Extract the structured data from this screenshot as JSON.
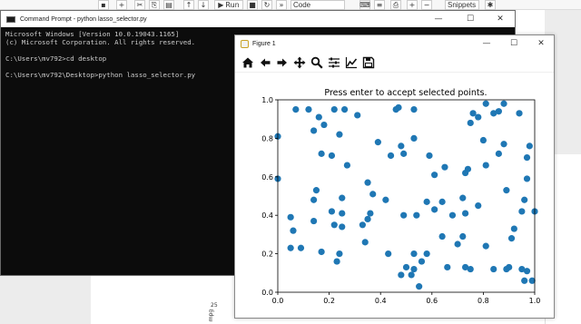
{
  "background": {
    "toolbar": {
      "run_label": "Run",
      "cell_type": "Code",
      "snippets_label": "Snippets"
    },
    "axis_tick": "25",
    "axis_label": "mpg"
  },
  "cmd": {
    "title": "Command Prompt - python  lasso_selector.py",
    "lines": [
      "Microsoft Windows [Version 10.0.19043.1165]",
      "(c) Microsoft Corporation. All rights reserved.",
      "",
      "C:\\Users\\mv792>cd desktop",
      "",
      "C:\\Users\\mv792\\Desktop>python lasso_selector.py"
    ]
  },
  "figure": {
    "title": "Figure 1",
    "toolbar_icons": [
      "home-icon",
      "back-arrow-icon",
      "forward-arrow-icon",
      "pan-icon",
      "zoom-icon",
      "subplots-icon",
      "axes-edit-icon",
      "save-icon"
    ]
  },
  "chart_data": {
    "type": "scatter",
    "title": "Press enter to accept selected points.",
    "xlabel": "",
    "ylabel": "",
    "xlim": [
      0,
      1
    ],
    "ylim": [
      0,
      1
    ],
    "xticks": [
      "0.0",
      "0.2",
      "0.4",
      "0.6",
      "0.8",
      "1.0"
    ],
    "yticks": [
      "0.0",
      "0.2",
      "0.4",
      "0.6",
      "0.8",
      "1.0"
    ],
    "grid": false,
    "color": "#1f77b4",
    "points": [
      [
        0.0,
        0.81
      ],
      [
        0.07,
        0.95
      ],
      [
        0.12,
        0.95
      ],
      [
        0.16,
        0.91
      ],
      [
        0.22,
        0.95
      ],
      [
        0.26,
        0.95
      ],
      [
        0.31,
        0.92
      ],
      [
        0.47,
        0.96
      ],
      [
        0.46,
        0.95
      ],
      [
        0.53,
        0.95
      ],
      [
        0.76,
        0.93
      ],
      [
        0.81,
        0.98
      ],
      [
        0.84,
        0.93
      ],
      [
        0.86,
        0.94
      ],
      [
        0.88,
        0.98
      ],
      [
        0.94,
        0.93
      ],
      [
        0.78,
        0.91
      ],
      [
        0.75,
        0.88
      ],
      [
        0.18,
        0.87
      ],
      [
        0.14,
        0.84
      ],
      [
        0.24,
        0.82
      ],
      [
        0.39,
        0.78
      ],
      [
        0.53,
        0.8
      ],
      [
        0.48,
        0.76
      ],
      [
        0.44,
        0.71
      ],
      [
        0.49,
        0.72
      ],
      [
        0.59,
        0.71
      ],
      [
        0.8,
        0.79
      ],
      [
        0.88,
        0.77
      ],
      [
        0.98,
        0.76
      ],
      [
        0.97,
        0.7
      ],
      [
        0.17,
        0.72
      ],
      [
        0.21,
        0.71
      ],
      [
        0.27,
        0.66
      ],
      [
        0.65,
        0.65
      ],
      [
        0.74,
        0.64
      ],
      [
        0.73,
        0.62
      ],
      [
        0.81,
        0.66
      ],
      [
        0.86,
        0.72
      ],
      [
        0.61,
        0.61
      ],
      [
        0.0,
        0.59
      ],
      [
        0.35,
        0.57
      ],
      [
        0.97,
        0.59
      ],
      [
        0.37,
        0.51
      ],
      [
        0.15,
        0.53
      ],
      [
        0.14,
        0.48
      ],
      [
        0.25,
        0.49
      ],
      [
        0.21,
        0.42
      ],
      [
        0.25,
        0.41
      ],
      [
        0.36,
        0.41
      ],
      [
        0.42,
        0.48
      ],
      [
        0.58,
        0.47
      ],
      [
        0.64,
        0.47
      ],
      [
        0.72,
        0.49
      ],
      [
        0.89,
        0.53
      ],
      [
        0.96,
        0.48
      ],
      [
        0.95,
        0.42
      ],
      [
        1.0,
        0.42
      ],
      [
        0.05,
        0.39
      ],
      [
        0.14,
        0.37
      ],
      [
        0.22,
        0.35
      ],
      [
        0.25,
        0.34
      ],
      [
        0.33,
        0.35
      ],
      [
        0.35,
        0.38
      ],
      [
        0.49,
        0.4
      ],
      [
        0.54,
        0.4
      ],
      [
        0.61,
        0.43
      ],
      [
        0.68,
        0.4
      ],
      [
        0.73,
        0.41
      ],
      [
        0.78,
        0.45
      ],
      [
        0.92,
        0.33
      ],
      [
        0.06,
        0.32
      ],
      [
        0.05,
        0.23
      ],
      [
        0.09,
        0.23
      ],
      [
        0.17,
        0.21
      ],
      [
        0.24,
        0.2
      ],
      [
        0.23,
        0.16
      ],
      [
        0.34,
        0.26
      ],
      [
        0.43,
        0.2
      ],
      [
        0.53,
        0.2
      ],
      [
        0.58,
        0.2
      ],
      [
        0.64,
        0.29
      ],
      [
        0.72,
        0.29
      ],
      [
        0.7,
        0.25
      ],
      [
        0.81,
        0.24
      ],
      [
        0.91,
        0.28
      ],
      [
        0.5,
        0.13
      ],
      [
        0.53,
        0.12
      ],
      [
        0.56,
        0.16
      ],
      [
        0.48,
        0.09
      ],
      [
        0.52,
        0.09
      ],
      [
        0.66,
        0.13
      ],
      [
        0.73,
        0.13
      ],
      [
        0.75,
        0.12
      ],
      [
        0.84,
        0.12
      ],
      [
        0.89,
        0.12
      ],
      [
        0.95,
        0.12
      ],
      [
        0.97,
        0.11
      ],
      [
        0.55,
        0.03
      ],
      [
        0.99,
        0.06
      ],
      [
        0.96,
        0.06
      ],
      [
        0.9,
        0.13
      ]
    ]
  }
}
